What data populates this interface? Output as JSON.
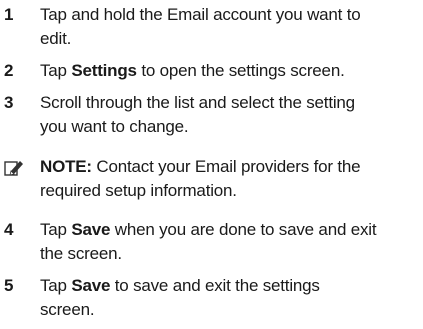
{
  "steps": [
    {
      "num": "1",
      "line1": "Tap and hold the Email account you want to",
      "line2": "edit."
    },
    {
      "num": "2",
      "pre": "Tap ",
      "bold": "Settings",
      "post": " to open the settings screen."
    },
    {
      "num": "3",
      "line1": "Scroll through the list and select the setting",
      "line2": "you want to change."
    },
    {
      "num": "4",
      "pre": "Tap ",
      "bold": "Save",
      "post": " when you are done to save and exit",
      "line2": "the screen."
    },
    {
      "num": "5",
      "pre": "Tap ",
      "bold": "Save",
      "post": " to save and exit the settings",
      "line2": "screen."
    }
  ],
  "note": {
    "icon": "note-pencil-icon",
    "label": "NOTE:",
    "text": " Contact your Email providers for the",
    "line2": "required setup information."
  }
}
